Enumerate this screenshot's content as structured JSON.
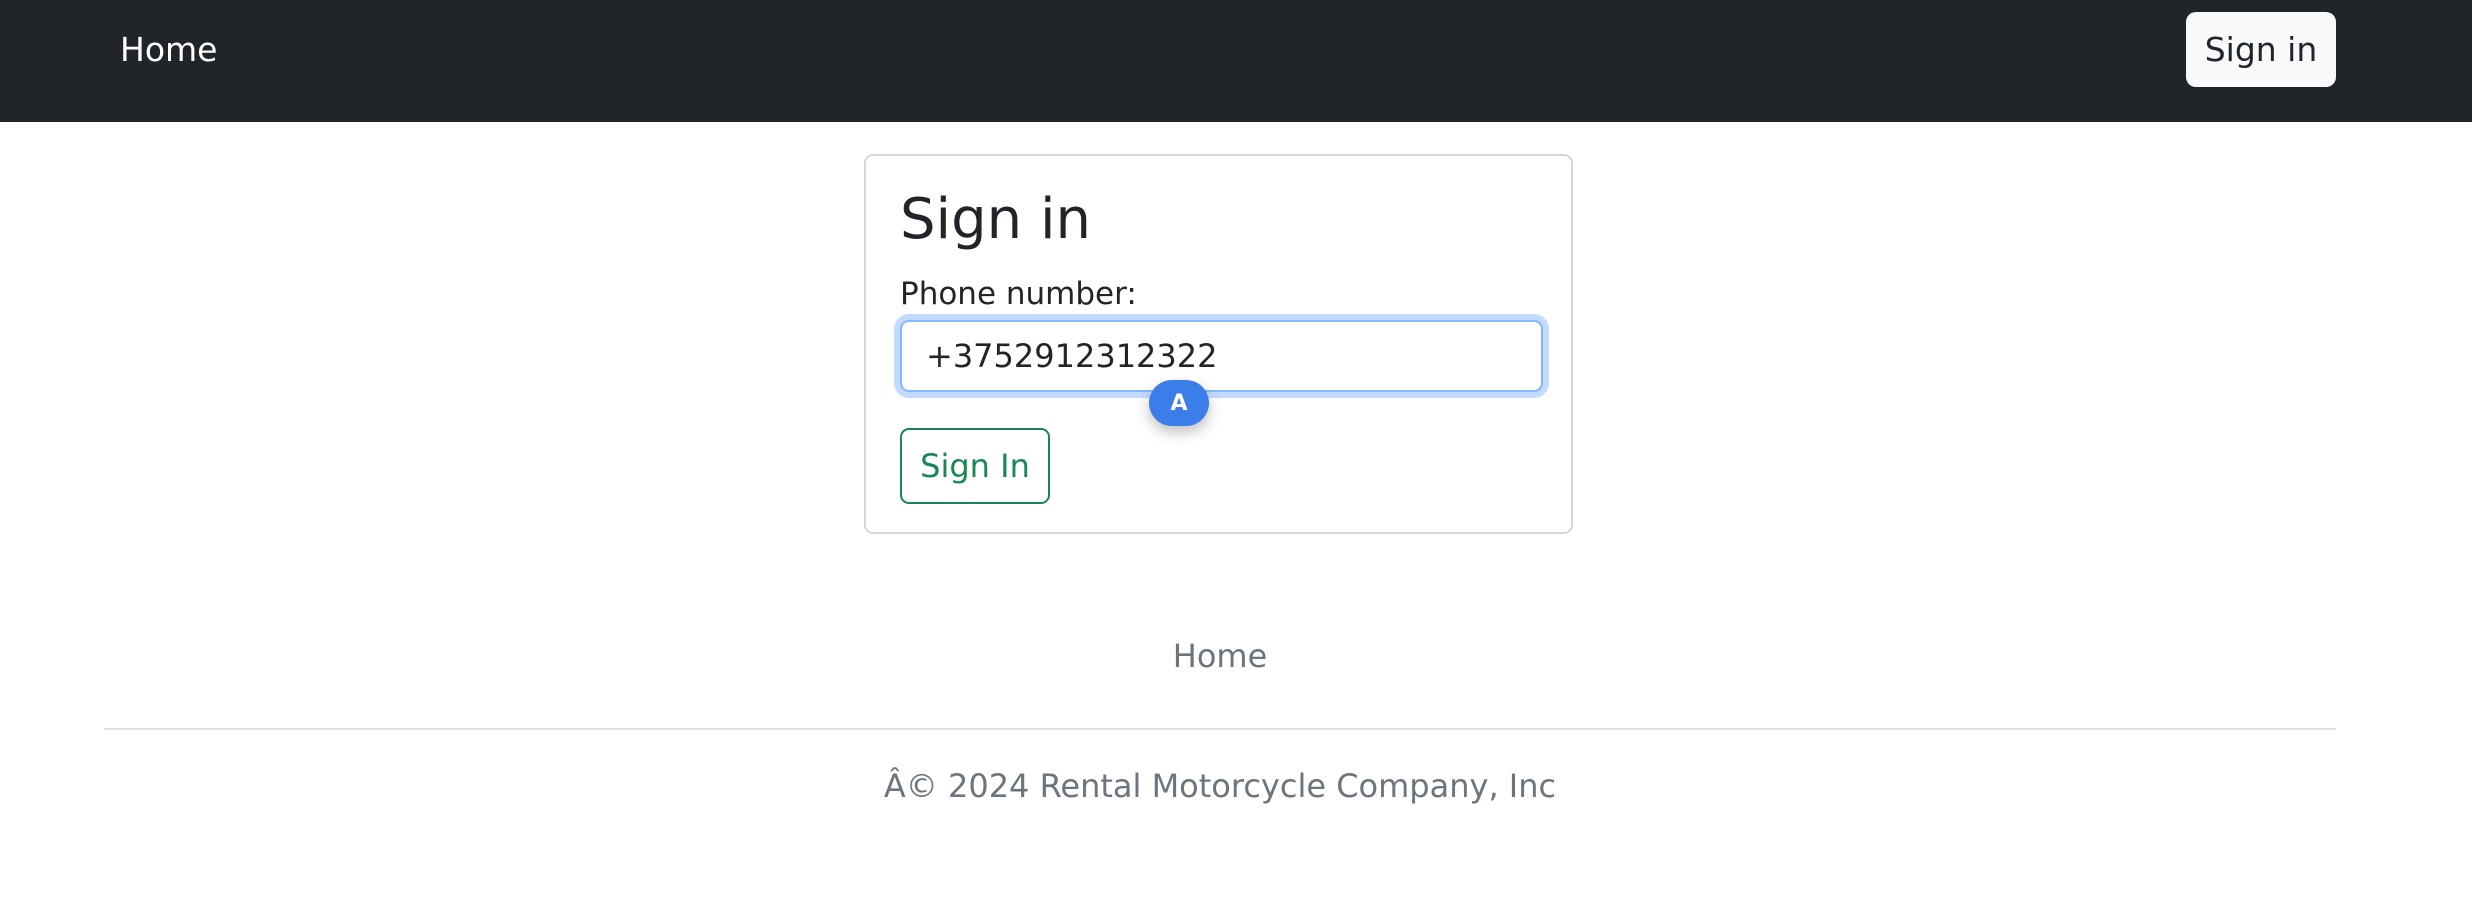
{
  "navbar": {
    "home_label": "Home",
    "signin_label": "Sign in"
  },
  "form": {
    "title": "Sign in",
    "phone_label": "Phone number:",
    "phone_value": "+3752912312322",
    "autofill_badge": "A",
    "submit_label": "Sign In"
  },
  "footer": {
    "home_label": "Home",
    "copyright": "Â© 2024 Rental Motorcycle Company, Inc"
  },
  "colors": {
    "navbar_bg": "#212529",
    "success": "#198754",
    "focus_border": "#86b7fe",
    "autofill_badge": "#3b7de9",
    "muted_text": "#6c757d"
  }
}
